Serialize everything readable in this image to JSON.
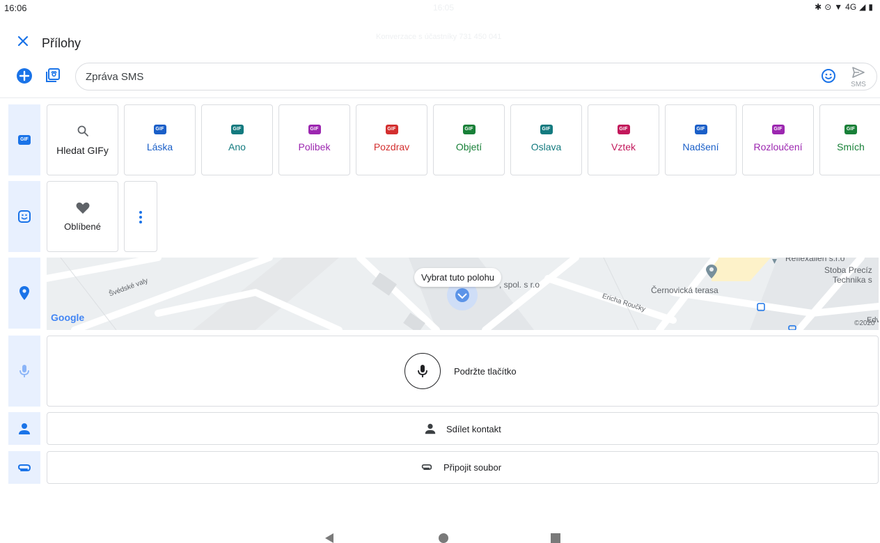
{
  "status_bar": {
    "time": "16:06",
    "ghost_time": "16:05",
    "network": "4G"
  },
  "header": {
    "title": "Přílohy",
    "ghost_subtitle": "Konverzace s účastníky 731 450 041"
  },
  "composer": {
    "placeholder": "Zpráva SMS",
    "send_label": "SMS"
  },
  "gif_row": {
    "search_label": "Hledat GIFy",
    "badge_text": "GIF",
    "categories": [
      {
        "label": "Láska",
        "color": "#1a5fc8"
      },
      {
        "label": "Ano",
        "color": "#137a7f"
      },
      {
        "label": "Polibek",
        "color": "#9c27b0"
      },
      {
        "label": "Pozdrav",
        "color": "#d32f2f"
      },
      {
        "label": "Objetí",
        "color": "#188038"
      },
      {
        "label": "Oslava",
        "color": "#137a7f"
      },
      {
        "label": "Vztek",
        "color": "#c2185b"
      },
      {
        "label": "Nadšení",
        "color": "#1a5fc8"
      },
      {
        "label": "Rozloučení",
        "color": "#9c27b0"
      },
      {
        "label": "Smích",
        "color": "#188038"
      }
    ]
  },
  "sticker_row": {
    "favorites_label": "Oblíbené"
  },
  "map": {
    "pill_text": "Vybrat tuto polohu",
    "logo_text": "Google",
    "copyright": "©2020",
    "labels": {
      "street_svedske": "Švédské valy",
      "spol": ", spol. s r.o",
      "ericha": "Ericha Roučky",
      "cernovicka": "Černovická terasa",
      "stoba1": "Stoba Precíz",
      "stoba2": "Technika s",
      "reflex": "Reflexallen s.r.o",
      "edge": "Edv"
    }
  },
  "voice": {
    "hold_label": "Podržte tlačítko"
  },
  "contact": {
    "label": "Sdílet kontakt"
  },
  "file": {
    "label": "Připojit soubor"
  },
  "colors": {
    "accent": "#1a73e8",
    "rail_bg": "#e8f0fe"
  }
}
